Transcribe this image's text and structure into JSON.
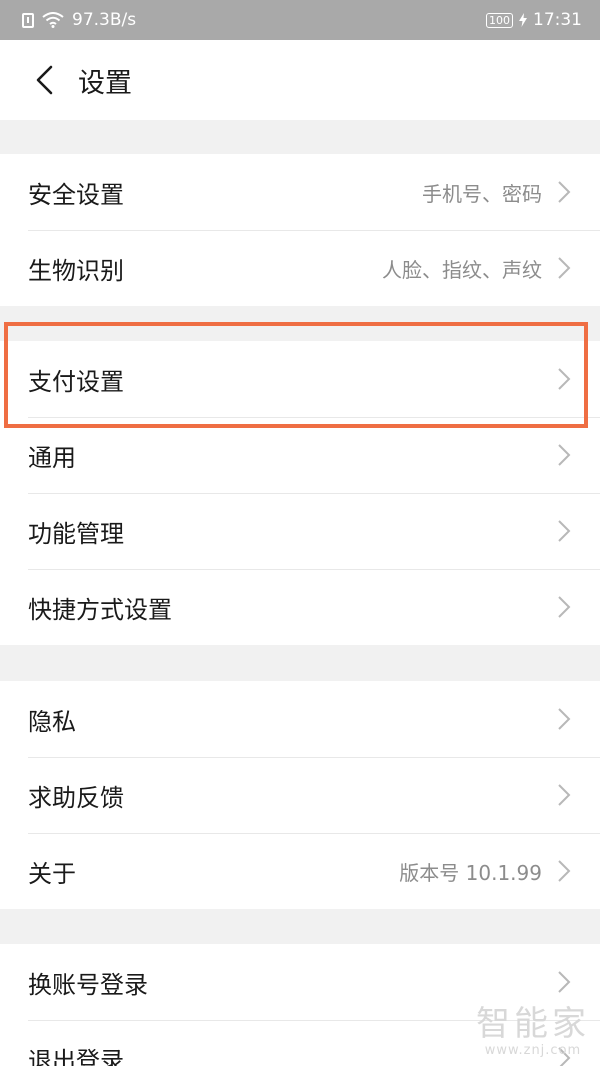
{
  "status_bar": {
    "speed": "97.3B/s",
    "battery": "100",
    "time": "17:31"
  },
  "header": {
    "title": "设置",
    "back_icon": "chevron-left-icon"
  },
  "groups": [
    {
      "items": [
        {
          "label": "安全设置",
          "value": "手机号、密码"
        },
        {
          "label": "生物识别",
          "value": "人脸、指纹、声纹"
        }
      ]
    },
    {
      "items": [
        {
          "label": "支付设置",
          "value": ""
        },
        {
          "label": "通用",
          "value": ""
        },
        {
          "label": "功能管理",
          "value": ""
        },
        {
          "label": "快捷方式设置",
          "value": ""
        }
      ]
    },
    {
      "items": [
        {
          "label": "隐私",
          "value": ""
        },
        {
          "label": "求助反馈",
          "value": ""
        },
        {
          "label": "关于",
          "value": "版本号 10.1.99"
        }
      ]
    },
    {
      "items": [
        {
          "label": "换账号登录",
          "value": ""
        },
        {
          "label": "退出登录",
          "value": ""
        }
      ]
    }
  ],
  "highlight": {
    "target": "支付设置",
    "color": "#ef6e43"
  },
  "watermark": {
    "brand": "智能家",
    "url": "www.znj.com"
  }
}
